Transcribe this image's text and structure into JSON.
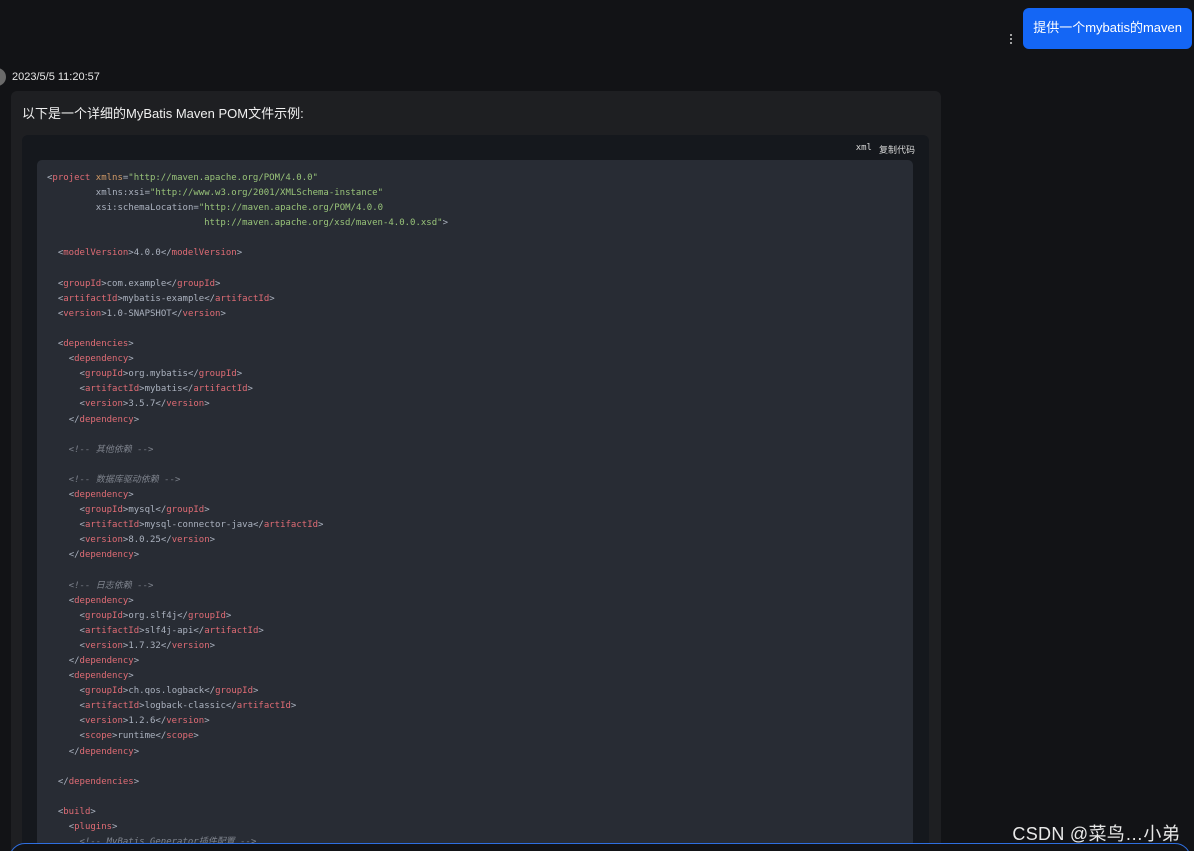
{
  "user_message": {
    "text": "提供一个mybatis的maven"
  },
  "assistant_message": {
    "timestamp": "2023/5/5 11:20:57",
    "intro": "以下是一个详细的MyBatis Maven POM文件示例:",
    "code_block": {
      "language": "xml",
      "copy_label": "复制代码",
      "lines": [
        "<project xmlns=\"http://maven.apache.org/POM/4.0.0\"",
        "         xmlns:xsi=\"http://www.w3.org/2001/XMLSchema-instance\"",
        "         xsi:schemaLocation=\"http://maven.apache.org/POM/4.0.0",
        "                             http://maven.apache.org/xsd/maven-4.0.0.xsd\">",
        "",
        "  <modelVersion>4.0.0</modelVersion>",
        "",
        "  <groupId>com.example</groupId>",
        "  <artifactId>mybatis-example</artifactId>",
        "  <version>1.0-SNAPSHOT</version>",
        "",
        "  <dependencies>",
        "    <dependency>",
        "      <groupId>org.mybatis</groupId>",
        "      <artifactId>mybatis</artifactId>",
        "      <version>3.5.7</version>",
        "    </dependency>",
        "",
        "    <!-- 其他依赖 -->",
        "",
        "    <!-- 数据库驱动依赖 -->",
        "    <dependency>",
        "      <groupId>mysql</groupId>",
        "      <artifactId>mysql-connector-java</artifactId>",
        "      <version>8.0.25</version>",
        "    </dependency>",
        "",
        "    <!-- 日志依赖 -->",
        "    <dependency>",
        "      <groupId>org.slf4j</groupId>",
        "      <artifactId>slf4j-api</artifactId>",
        "      <version>1.7.32</version>",
        "    </dependency>",
        "    <dependency>",
        "      <groupId>ch.qos.logback</groupId>",
        "      <artifactId>logback-classic</artifactId>",
        "      <version>1.2.6</version>",
        "      <scope>runtime</scope>",
        "    </dependency>",
        "",
        "  </dependencies>",
        "",
        "  <build>",
        "    <plugins>",
        "      <!-- MyBatis Generator插件配置 -->"
      ]
    }
  },
  "watermark": "CSDN @菜鸟…小弟",
  "colors": {
    "background": "#121316",
    "user_bubble": "#1466f5",
    "panel": "#1e1f22",
    "code_bg": "#282c34",
    "tag": "#e06c75",
    "attr_name": "#d19a66",
    "attr_value": "#98c379",
    "comment": "#7f848e",
    "text": "#abb2bf"
  }
}
